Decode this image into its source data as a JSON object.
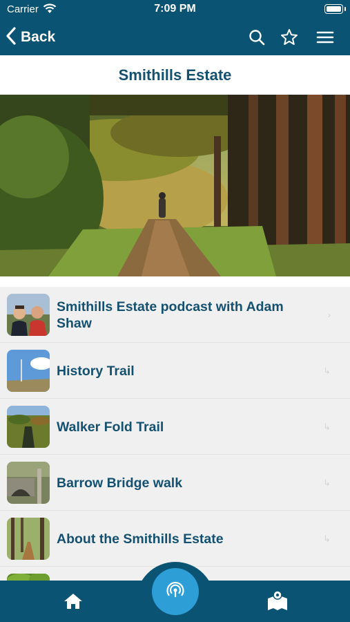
{
  "status": {
    "carrier": "Carrier",
    "time": "7:09 PM"
  },
  "nav": {
    "back_label": "Back",
    "icons": [
      "search-icon",
      "star-icon",
      "menu-icon"
    ]
  },
  "page": {
    "title": "Smithills Estate"
  },
  "items": [
    {
      "label": "Smithills Estate podcast with Adam Shaw",
      "thumb": "podcast-hosts-photo",
      "arrow": "›"
    },
    {
      "label": "History Trail",
      "thumb": "hilltop-mast-photo",
      "arrow": "↳"
    },
    {
      "label": "Walker Fold Trail",
      "thumb": "moorland-stream-photo",
      "arrow": "↳"
    },
    {
      "label": "Barrow Bridge walk",
      "thumb": "stone-bridge-photo",
      "arrow": "↳"
    },
    {
      "label": "About the Smithills Estate",
      "thumb": "woodland-path-photo",
      "arrow": "↳"
    },
    {
      "label": "",
      "thumb": "green-trees-photo",
      "arrow": ""
    }
  ],
  "tabbar": {
    "icons": [
      "home-icon",
      "audio-guide-icon",
      "map-icon"
    ]
  },
  "colors": {
    "brand": "#0b5373",
    "accent": "#2d9fd6",
    "title_text": "#14506f",
    "list_bg": "#f0f0f0"
  }
}
